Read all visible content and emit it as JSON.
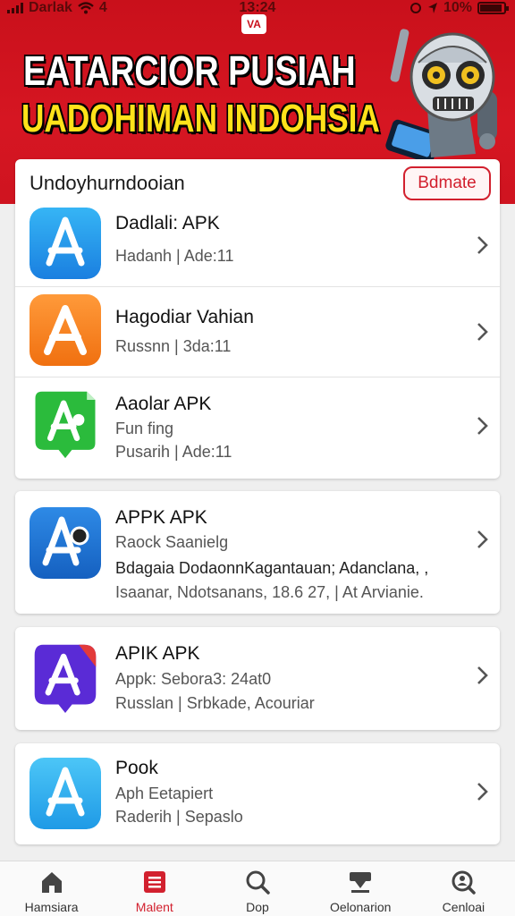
{
  "status_bar": {
    "carrier": "Darlak",
    "signal_strength": "4",
    "time": "13:24",
    "battery": "10%"
  },
  "hero": {
    "logo_text": "VA",
    "title": "EATARCIOR PUSIAH",
    "subtitle": "UADOHIMAN INDOHSIA"
  },
  "card1": {
    "header_title": "Undoyhurndooian",
    "update_button": "Bdmate",
    "items": [
      {
        "name": "Dadlali: APK",
        "sub1": "Hadanh | Ade:11",
        "icon": "app-store-blue-icon"
      },
      {
        "name": "Hagodiar Vahian",
        "sub1": "Russnn | 3da:11",
        "icon": "app-orange-a-icon"
      },
      {
        "name": "Aaolar APK",
        "sub1": "Fun fing",
        "sub2": "Pusarih | Ade:11",
        "icon": "app-green-a-icon"
      }
    ]
  },
  "card2": {
    "items": [
      {
        "name": "APPK APK",
        "sub1": "Raock Saanielg",
        "sub2": "Bdagaia DodaonnKagantauan; Adanclana, ,",
        "sub3": "Isaanar, Ndotsanans, 18.6 27, | At Arvianie.",
        "icon": "app-blue-a-icon"
      }
    ]
  },
  "card3": {
    "items": [
      {
        "name": "APIK APK",
        "sub1": "Appk: Sebora3: 24at0",
        "sub2": "Russlan | Srbkade, Acouriar",
        "icon": "app-purple-a-icon"
      }
    ]
  },
  "card4": {
    "items": [
      {
        "name": "Pook",
        "sub1": "Aph Eetapiert",
        "sub2": "Raderih | Sepaslo",
        "icon": "app-light-blue-a-icon"
      }
    ]
  },
  "bottom_nav": [
    {
      "label": "Hamsiara",
      "icon": "home-icon",
      "active": false
    },
    {
      "label": "Malent",
      "icon": "list-icon",
      "active": true
    },
    {
      "label": "Dop",
      "icon": "search-icon",
      "active": false
    },
    {
      "label": "Oelonarion",
      "icon": "download-icon",
      "active": false
    },
    {
      "label": "Cenloai",
      "icon": "account-search-icon",
      "active": false
    }
  ],
  "colors": {
    "brand_red": "#d2202e",
    "title_yellow": "#ffe21a"
  }
}
